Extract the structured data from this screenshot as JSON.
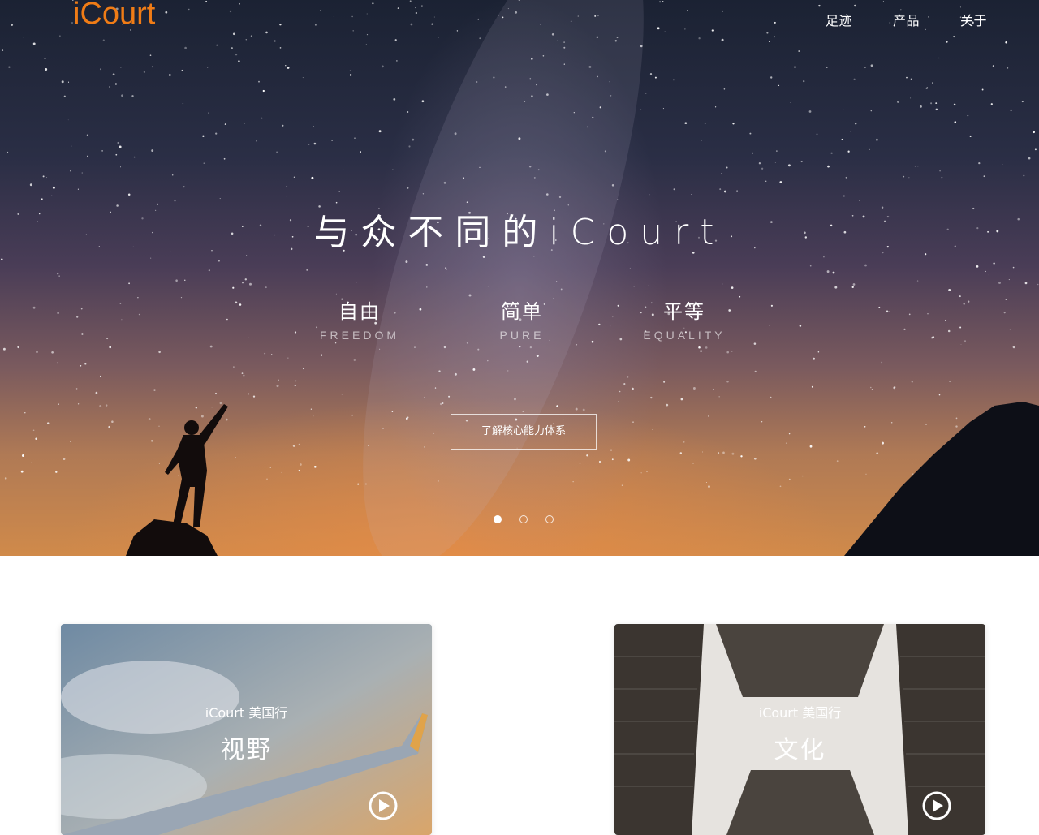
{
  "header": {
    "logo": "iCourt",
    "nav": [
      "足迹",
      "产品",
      "关于"
    ]
  },
  "hero": {
    "headline": "与众不同的iCourt",
    "values": [
      {
        "zh": "自由",
        "en": "FREEDOM"
      },
      {
        "zh": "简单",
        "en": "PURE"
      },
      {
        "zh": "平等",
        "en": "EQUALITY"
      }
    ],
    "cta": "了解核心能力体系",
    "slides": 3,
    "active_slide": 1
  },
  "cards": [
    {
      "subtitle": "iCourt 美国行",
      "title": "视野",
      "icon": "play-icon"
    },
    {
      "subtitle": "iCourt 美国行",
      "title": "文化",
      "icon": "play-icon"
    }
  ],
  "colors": {
    "brand": "#f07c16",
    "hero_text": "#ffffff"
  }
}
